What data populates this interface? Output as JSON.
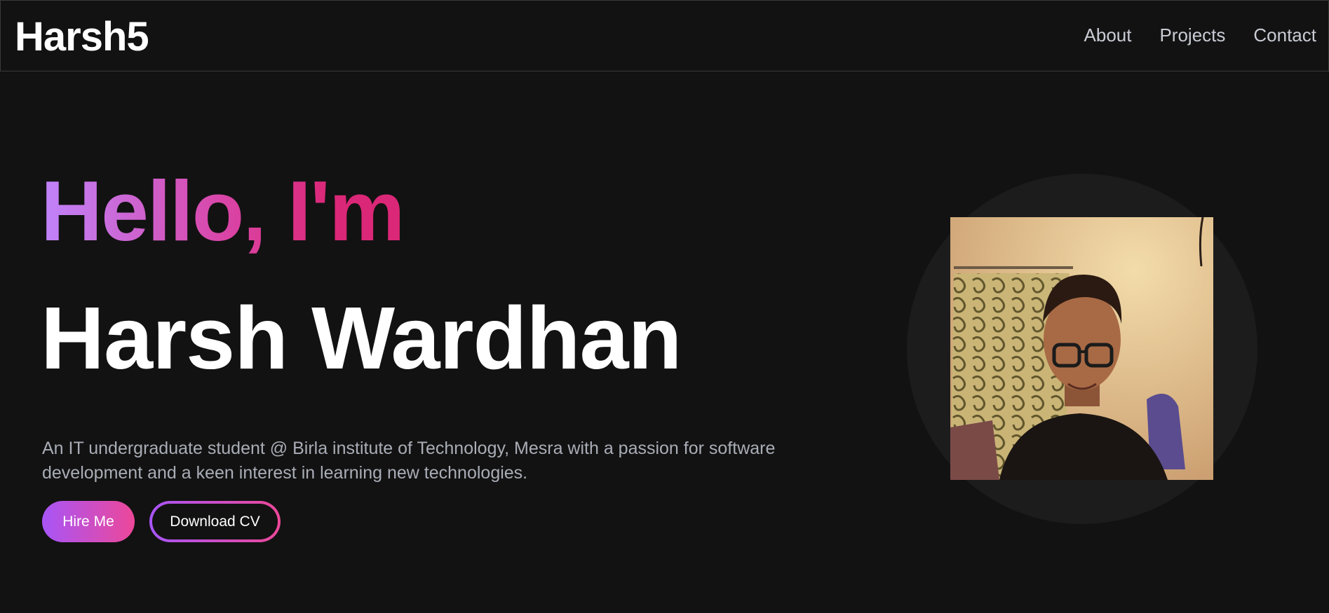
{
  "nav": {
    "brand": "Harsh5",
    "links": [
      {
        "label": "About"
      },
      {
        "label": "Projects"
      },
      {
        "label": "Contact"
      }
    ]
  },
  "hero": {
    "greeting": "Hello, I'm",
    "name": "Harsh Wardhan",
    "bio": "An IT undergraduate student @ Birla institute of Technology, Mesra with a passion for software development and a keen interest in learning new technologies.",
    "buttons": {
      "hire": "Hire Me",
      "download": "Download CV"
    }
  },
  "colors": {
    "background": "#121212",
    "accent_start": "#a855f7",
    "accent_end": "#ec4899"
  }
}
